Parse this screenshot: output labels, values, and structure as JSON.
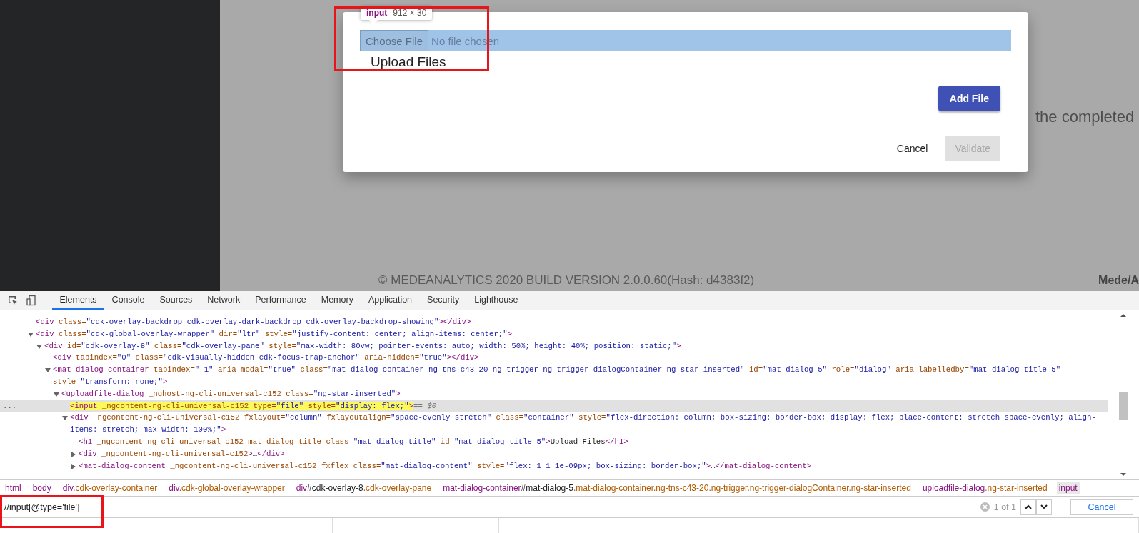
{
  "page": {
    "background_text": "the completed",
    "footer": "© MEDEANALYTICS 2020 BUILD VERSION 2.0.0.60(Hash: d4383f2)",
    "logo": "Mede/A"
  },
  "dialog": {
    "tooltip": {
      "tag": "input",
      "size": "912 × 30"
    },
    "file_input": {
      "button": "Choose File",
      "status": "No file chosen",
      "inspected": true
    },
    "title": "Upload Files",
    "add_button": "Add File",
    "cancel_button": "Cancel",
    "validate_button": {
      "label": "Validate",
      "disabled": true
    }
  },
  "devtools": {
    "tabs": [
      {
        "label": "Elements",
        "selected": true
      },
      {
        "label": "Console",
        "selected": false
      },
      {
        "label": "Sources",
        "selected": false
      },
      {
        "label": "Network",
        "selected": false
      },
      {
        "label": "Performance",
        "selected": false
      },
      {
        "label": "Memory",
        "selected": false
      },
      {
        "label": "Application",
        "selected": false
      },
      {
        "label": "Security",
        "selected": false
      },
      {
        "label": "Lighthouse",
        "selected": false
      }
    ],
    "dom_tree": [
      {
        "code": "<div class=\"cdk-overlay-backdrop cdk-overlay-dark-backdrop cdk-overlay-backdrop-showing\"></div>",
        "selected": false
      },
      {
        "code": "<div class=\"cdk-global-overlay-wrapper\" dir=\"ltr\" style=\"justify-content: center; align-items: center;\">",
        "expanded": true,
        "selected": false,
        "children": [
          {
            "code": "<div id=\"cdk-overlay-8\" class=\"cdk-overlay-pane\" style=\"max-width: 80vw; pointer-events: auto; width: 50%; height: 40%; position: static;\">",
            "expanded": true,
            "selected": false,
            "children": [
              {
                "code": "<div tabindex=\"0\" class=\"cdk-visually-hidden cdk-focus-trap-anchor\" aria-hidden=\"true\"></div>",
                "selected": false
              },
              {
                "code": "<mat-dialog-container tabindex=\"-1\" aria-modal=\"true\" class=\"mat-dialog-container ng-tns-c43-20 ng-trigger ng-trigger-dialogContainer ng-star-inserted\" id=\"mat-dialog-5\" role=\"dialog\" aria-labelledby=\"mat-dialog-title-5\" style=\"transform: none;\">",
                "expanded": true,
                "selected": false,
                "children": [
                  {
                    "code": "<uploadfile-dialog _nghost-ng-cli-universal-c152 class=\"ng-star-inserted\">",
                    "expanded": true,
                    "selected": false,
                    "children": [
                      {
                        "code": "<input _ngcontent-ng-cli-universal-c152 type=\"file\" style=\"display: flex;\">",
                        "selected": true,
                        "row_menu": "...",
                        "console_ref": "== $0"
                      },
                      {
                        "code": "<div _ngcontent-ng-cli-universal-c152 fxlayout=\"column\" fxlayoutalign=\"space-evenly stretch\" class=\"container\" style=\"flex-direction: column; box-sizing: border-box; display: flex; place-content: stretch space-evenly; align-items: stretch; max-width: 100%;\">",
                        "expanded": true,
                        "selected": false,
                        "children": [
                          {
                            "code": "<h1 _ngcontent-ng-cli-universal-c152 mat-dialog-title class=\"mat-dialog-title\" id=\"mat-dialog-title-5\">Upload Files</h1>",
                            "selected": false
                          },
                          {
                            "code": "<div _ngcontent-ng-cli-universal-c152>…</div>",
                            "expanded": false,
                            "selected": false
                          },
                          {
                            "code": "<mat-dialog-content _ngcontent-ng-cli-universal-c152 fxflex class=\"mat-dialog-content\" style=\"flex: 1 1 1e-09px; box-sizing: border-box;\">…</mat-dialog-content>",
                            "expanded": false,
                            "selected": false
                          }
                        ]
                      }
                    ]
                  }
                ]
              }
            ]
          }
        ]
      }
    ],
    "breadcrumbs": [
      {
        "label": "html",
        "selected": false
      },
      {
        "label": "body",
        "selected": false
      },
      {
        "label": "div.cdk-overlay-container",
        "selected": false
      },
      {
        "label": "div.cdk-global-overlay-wrapper",
        "selected": false
      },
      {
        "label": "div#cdk-overlay-8.cdk-overlay-pane",
        "selected": false
      },
      {
        "label": "mat-dialog-container#mat-dialog-5.mat-dialog-container.ng-tns-c43-20.ng-trigger.ng-trigger-dialogContainer.ng-star-inserted",
        "selected": false
      },
      {
        "label": "uploadfile-dialog.ng-star-inserted",
        "selected": false
      },
      {
        "label": "input",
        "selected": true
      }
    ],
    "search": {
      "value": "//input[@type='file']",
      "count": "1 of 1",
      "cancel": "Cancel"
    }
  },
  "annotations": [
    {
      "kind": "red-box"
    },
    {
      "kind": "red-box"
    }
  ]
}
